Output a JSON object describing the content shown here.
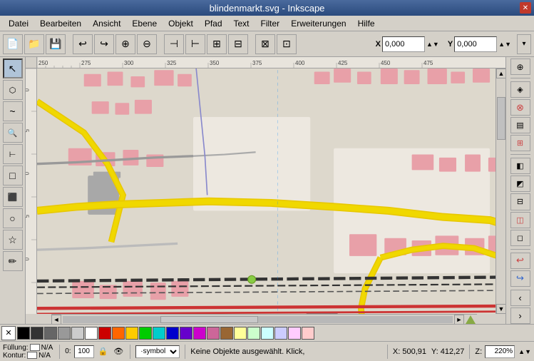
{
  "titlebar": {
    "title": "blindenmarkt.svg - Inkscape",
    "close_label": "✕"
  },
  "menubar": {
    "items": [
      "Datei",
      "Bearbeiten",
      "Ansicht",
      "Ebene",
      "Objekt",
      "Pfad",
      "Text",
      "Filter",
      "Erweiterungen",
      "Hilfe"
    ]
  },
  "toolbar": {
    "x_label": "X",
    "y_label": "Y",
    "x_value": "0,000",
    "y_value": "0,000",
    "expand_label": "▾"
  },
  "left_tools": [
    {
      "name": "selector",
      "icon": "↖",
      "active": true
    },
    {
      "name": "node-editor",
      "icon": "⬡"
    },
    {
      "name": "tweak",
      "icon": "~"
    },
    {
      "name": "zoom",
      "icon": "🔍"
    },
    {
      "name": "measure",
      "icon": "⊢"
    },
    {
      "name": "rectangle",
      "icon": "□"
    },
    {
      "name": "3d-box",
      "icon": "⬛"
    },
    {
      "name": "ellipse",
      "icon": "○"
    },
    {
      "name": "star",
      "icon": "☆"
    },
    {
      "name": "pencil",
      "icon": "✏"
    }
  ],
  "right_tools": [
    {
      "name": "snap1",
      "icon": "⊕"
    },
    {
      "name": "snap2",
      "icon": "◈"
    },
    {
      "name": "snap3",
      "icon": "⊗"
    },
    {
      "name": "snap4",
      "icon": "▤"
    },
    {
      "name": "snap5",
      "icon": "◧"
    },
    {
      "name": "snap6",
      "icon": "◩"
    },
    {
      "name": "snap7",
      "icon": "⊞"
    },
    {
      "name": "snap8",
      "icon": "⊟"
    },
    {
      "name": "snap9",
      "icon": "◫"
    },
    {
      "name": "snap10",
      "icon": "◻"
    },
    {
      "name": "snap11",
      "icon": "◼"
    },
    {
      "name": "snap12",
      "icon": "◾"
    },
    {
      "name": "chevron-left",
      "icon": "‹"
    },
    {
      "name": "chevron-right",
      "icon": "›"
    }
  ],
  "statusbar": {
    "fill_label": "Füllung:",
    "fill_value": "N/A",
    "stroke_label": "Kontur:",
    "stroke_value": "N/A",
    "opacity_value": "0:",
    "opacity_number": "100",
    "style_value": "·symbol",
    "message": "Keine Objekte ausgewählt. Klick,",
    "x_label": "X:",
    "x_value": "500,91",
    "y_label": "Y:",
    "y_value": "412,27",
    "z_label": "Z:",
    "zoom_value": "220%"
  },
  "ruler": {
    "top_ticks": [
      "250",
      "275",
      "300",
      "325",
      "350",
      "375",
      "400",
      "425",
      "450",
      "475"
    ],
    "left_ticks": [
      "0",
      "5",
      "0",
      "5",
      "0"
    ]
  }
}
